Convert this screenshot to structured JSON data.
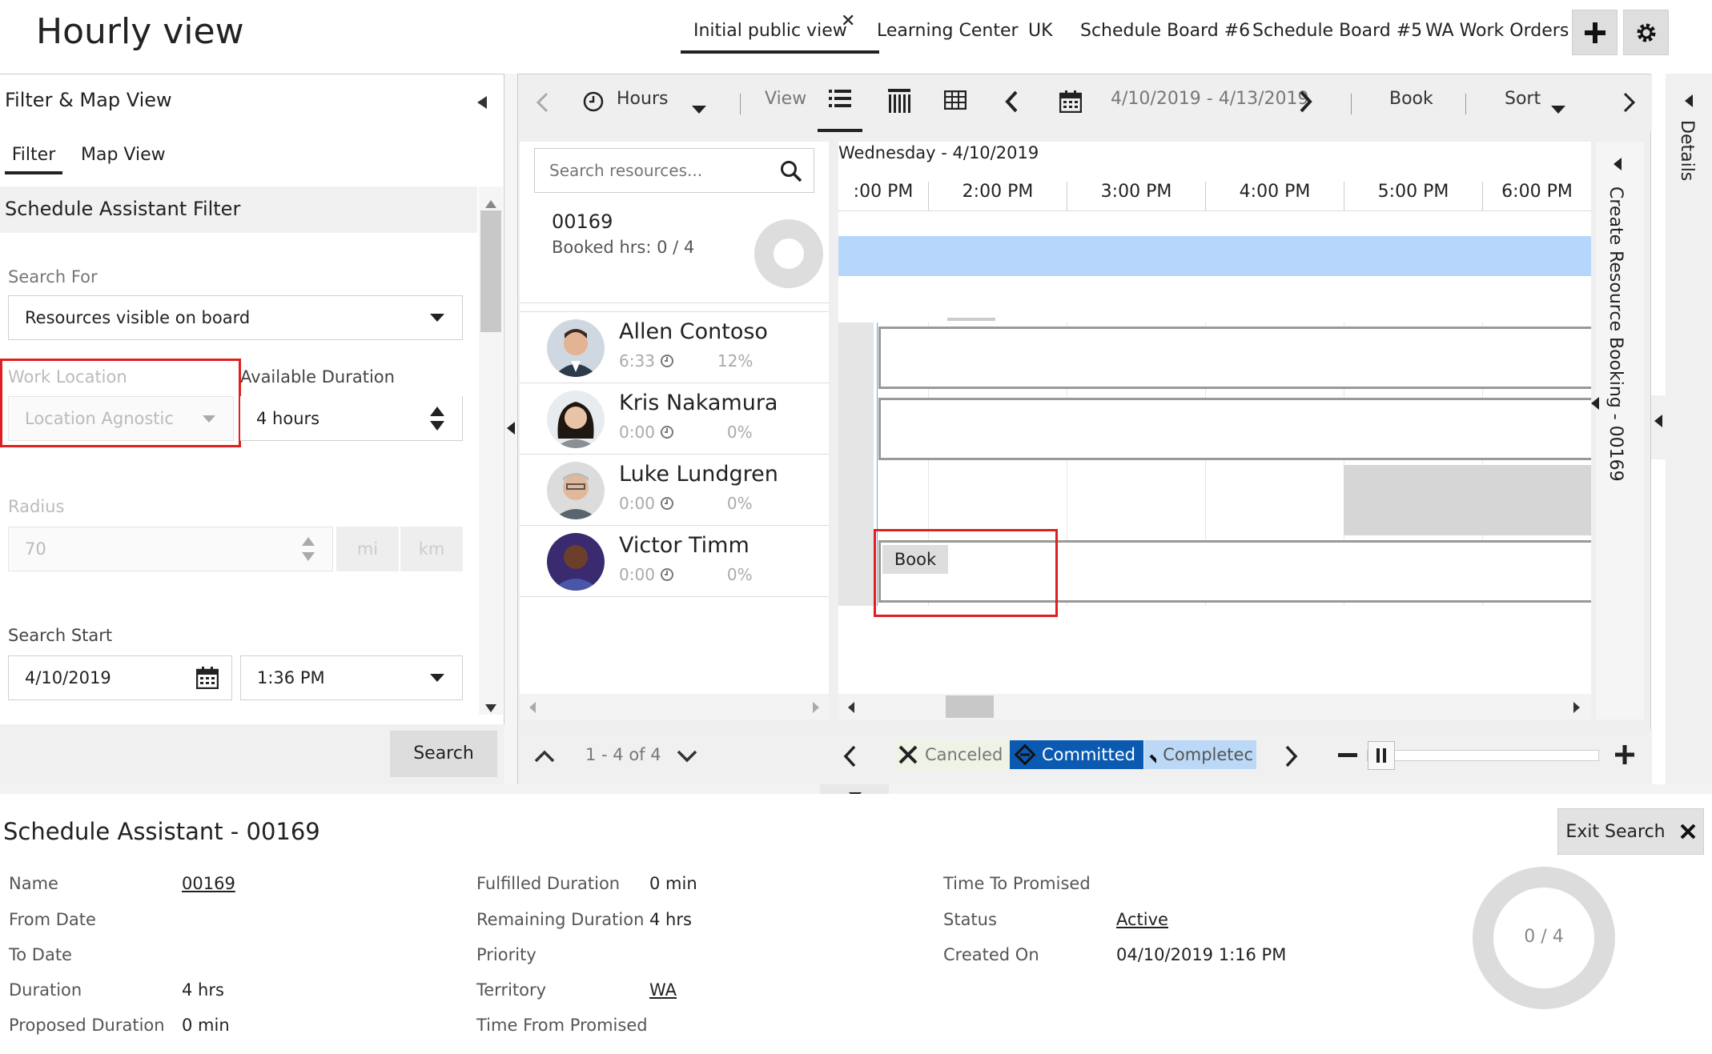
{
  "header": {
    "title": "Hourly view",
    "tabs": [
      "Initial public view",
      "Learning Center",
      "UK",
      "Schedule Board #6",
      "Schedule Board #5",
      "WA Work Orders"
    ]
  },
  "left_panel": {
    "title": "Filter & Map View",
    "tabs": [
      "Filter",
      "Map View"
    ],
    "section_title": "Schedule Assistant Filter",
    "search_for": {
      "label": "Search For",
      "value": "Resources visible on board"
    },
    "work_location": {
      "label": "Work Location",
      "value": "Location Agnostic"
    },
    "available_duration": {
      "label": "Available Duration",
      "value": "4 hours"
    },
    "radius": {
      "label": "Radius",
      "value": "70",
      "unit_mi": "mi",
      "unit_km": "km"
    },
    "search_start": {
      "label": "Search Start",
      "date": "4/10/2019",
      "time": "1:36 PM"
    },
    "search_button": "Search"
  },
  "toolbar": {
    "hours": "Hours",
    "view": "View",
    "date_range": "4/10/2019 - 4/13/2019",
    "book": "Book",
    "sort": "Sort"
  },
  "resources": {
    "search_placeholder": "Search resources...",
    "requirement": {
      "id": "00169",
      "booked": "Booked hrs: 0 / 4"
    },
    "rows": [
      {
        "name": "Allen Contoso",
        "hours": "6:33",
        "pct": "12%"
      },
      {
        "name": "Kris Nakamura",
        "hours": "0:00",
        "pct": "0%"
      },
      {
        "name": "Luke Lundgren",
        "hours": "0:00",
        "pct": "0%"
      },
      {
        "name": "Victor Timm",
        "hours": "0:00",
        "pct": "0%"
      }
    ],
    "pager": "1 - 4 of 4"
  },
  "grid": {
    "day": "Wednesday - 4/10/2019",
    "hours": [
      ":00 PM",
      "2:00 PM",
      "3:00 PM",
      "4:00 PM",
      "5:00 PM",
      "6:00 PM"
    ],
    "book_label": "Book"
  },
  "legend": {
    "canceled": "Canceled",
    "committed": "Committed",
    "completed": "Completec"
  },
  "side": {
    "create_booking": "Create Resource Booking - 00169",
    "details": "Details"
  },
  "bottom": {
    "title": "Schedule Assistant - 00169",
    "exit": "Exit Search",
    "col1": [
      {
        "label": "Name",
        "value": "00169"
      },
      {
        "label": "From Date",
        "value": ""
      },
      {
        "label": "To Date",
        "value": ""
      },
      {
        "label": "Duration",
        "value": "4 hrs"
      },
      {
        "label": "Proposed Duration",
        "value": "0 min"
      }
    ],
    "col2": [
      {
        "label": "Fulfilled Duration",
        "value": "0 min"
      },
      {
        "label": "Remaining Duration",
        "value": "4 hrs"
      },
      {
        "label": "Priority",
        "value": ""
      },
      {
        "label": "Territory",
        "value": "WA"
      },
      {
        "label": "Time From Promised",
        "value": ""
      }
    ],
    "col3": [
      {
        "label": "Time To Promised",
        "value": ""
      },
      {
        "label": "Status",
        "value": "Active"
      },
      {
        "label": "Created On",
        "value": "04/10/2019 1:16 PM"
      }
    ],
    "donut": "0 / 4"
  },
  "colors": {
    "accent_blue": "#b6d6fb",
    "committed": "#0b5ab2",
    "completed": "#bcd8f7",
    "highlight": "#e02020"
  }
}
